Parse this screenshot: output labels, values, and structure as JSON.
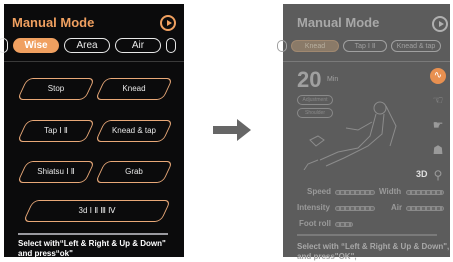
{
  "left": {
    "title": "Manual Mode",
    "tabs": [
      {
        "label": "",
        "active": false
      },
      {
        "label": "Wise",
        "active": true
      },
      {
        "label": "Area",
        "active": false
      },
      {
        "label": "Air",
        "active": false
      },
      {
        "label": "",
        "active": false
      }
    ],
    "buttons": {
      "stop": "Stop",
      "knead": "Knead",
      "tap": "Tap Ⅰ Ⅱ",
      "knead_tap": "Knead & tap",
      "shiatsu": "Shiatsu Ⅰ Ⅱ",
      "grab": "Grab",
      "three_d": "3d Ⅰ Ⅱ Ⅲ Ⅳ"
    },
    "hint_line1": "Select with“Left & Right & Up & Down\"",
    "hint_line2": "and press“ok\""
  },
  "right": {
    "title": "Manual Mode",
    "tabs": [
      {
        "label": "",
        "active": false
      },
      {
        "label": "Knead",
        "active": true
      },
      {
        "label": "Tap Ⅰ Ⅱ",
        "active": false
      },
      {
        "label": "Knead & tap",
        "active": false
      }
    ],
    "timer_value": "20",
    "timer_unit": "Min",
    "adjust_label": "Adjustment",
    "shoulder_label": "Shoulder",
    "badge_3d": "3D",
    "stats": {
      "speed": "Speed",
      "width": "Width",
      "intensity": "Intensity",
      "air": "Air",
      "foot_roll": "Foot roll"
    },
    "hint_line1": "Select with “Left & Right & Up & Down\",",
    "hint_line2": "and press\"OK\","
  },
  "colors": {
    "accent": "#f0a060",
    "left_bg": "#0b0b0c",
    "right_bg": "#5c5c5c"
  },
  "icons": [
    "play-icon",
    "arrow-right-icon",
    "massage-mode-icon",
    "hand-icon",
    "foot-icon"
  ]
}
